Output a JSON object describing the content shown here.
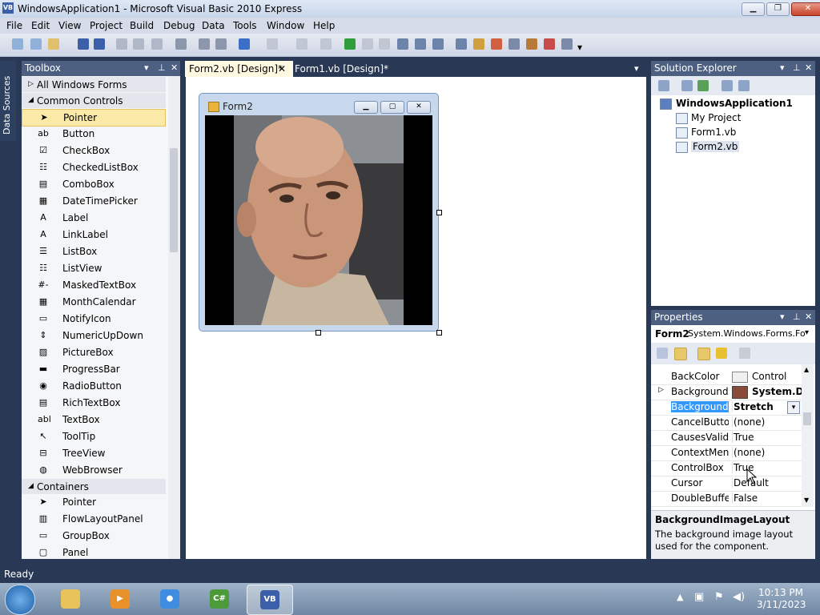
{
  "window": {
    "title": "WindowsApplication1 - Microsoft Visual Basic 2010 Express",
    "app_icon": "VB"
  },
  "menu": [
    "File",
    "Edit",
    "View",
    "Project",
    "Build",
    "Debug",
    "Data",
    "Tools",
    "Window",
    "Help"
  ],
  "data_sources_tab": "Data Sources",
  "toolbox": {
    "title": "Toolbox",
    "rows": [
      {
        "type": "group",
        "label": "All Windows Forms",
        "expanded": false
      },
      {
        "type": "group",
        "label": "Common Controls",
        "expanded": true
      },
      {
        "type": "item",
        "label": "Pointer",
        "icon": "pointer-icon",
        "glyph": "➤",
        "selected": true
      },
      {
        "type": "item",
        "label": "Button",
        "icon": "button-icon",
        "glyph": "ab"
      },
      {
        "type": "item",
        "label": "CheckBox",
        "icon": "checkbox-icon",
        "glyph": "☑"
      },
      {
        "type": "item",
        "label": "CheckedListBox",
        "icon": "checkedlistbox-icon",
        "glyph": "☷"
      },
      {
        "type": "item",
        "label": "ComboBox",
        "icon": "combobox-icon",
        "glyph": "▤"
      },
      {
        "type": "item",
        "label": "DateTimePicker",
        "icon": "datetimepicker-icon",
        "glyph": "▦"
      },
      {
        "type": "item",
        "label": "Label",
        "icon": "label-icon",
        "glyph": "A"
      },
      {
        "type": "item",
        "label": "LinkLabel",
        "icon": "linklabel-icon",
        "glyph": "A"
      },
      {
        "type": "item",
        "label": "ListBox",
        "icon": "listbox-icon",
        "glyph": "☰"
      },
      {
        "type": "item",
        "label": "ListView",
        "icon": "listview-icon",
        "glyph": "☷"
      },
      {
        "type": "item",
        "label": "MaskedTextBox",
        "icon": "maskedtextbox-icon",
        "glyph": "#-"
      },
      {
        "type": "item",
        "label": "MonthCalendar",
        "icon": "monthcalendar-icon",
        "glyph": "▦"
      },
      {
        "type": "item",
        "label": "NotifyIcon",
        "icon": "notifyicon-icon",
        "glyph": "▭"
      },
      {
        "type": "item",
        "label": "NumericUpDown",
        "icon": "numericupdown-icon",
        "glyph": "⇕"
      },
      {
        "type": "item",
        "label": "PictureBox",
        "icon": "picturebox-icon",
        "glyph": "▨"
      },
      {
        "type": "item",
        "label": "ProgressBar",
        "icon": "progressbar-icon",
        "glyph": "▬"
      },
      {
        "type": "item",
        "label": "RadioButton",
        "icon": "radiobutton-icon",
        "glyph": "◉"
      },
      {
        "type": "item",
        "label": "RichTextBox",
        "icon": "richtextbox-icon",
        "glyph": "▤"
      },
      {
        "type": "item",
        "label": "TextBox",
        "icon": "textbox-icon",
        "glyph": "abl"
      },
      {
        "type": "item",
        "label": "ToolTip",
        "icon": "tooltip-icon",
        "glyph": "↖"
      },
      {
        "type": "item",
        "label": "TreeView",
        "icon": "treeview-icon",
        "glyph": "⊟"
      },
      {
        "type": "item",
        "label": "WebBrowser",
        "icon": "webbrowser-icon",
        "glyph": "◍"
      },
      {
        "type": "group",
        "label": "Containers",
        "expanded": true
      },
      {
        "type": "item",
        "label": "Pointer",
        "icon": "pointer-icon",
        "glyph": "➤"
      },
      {
        "type": "item",
        "label": "FlowLayoutPanel",
        "icon": "flowlayoutpanel-icon",
        "glyph": "▥"
      },
      {
        "type": "item",
        "label": "GroupBox",
        "icon": "groupbox-icon",
        "glyph": "▭"
      },
      {
        "type": "item",
        "label": "Panel",
        "icon": "panel-icon",
        "glyph": "▢"
      }
    ]
  },
  "doc_tabs": [
    {
      "label": "Form2.vb [Design]*",
      "active": true
    },
    {
      "label": "Form1.vb [Design]*",
      "active": false
    }
  ],
  "form2": {
    "title": "Form2"
  },
  "solution_explorer": {
    "title": "Solution Explorer",
    "root": "WindowsApplication1",
    "items": [
      "My Project",
      "Form1.vb",
      "Form2.vb"
    ]
  },
  "properties": {
    "title": "Properties",
    "object_name": "Form2",
    "object_type": "System.Windows.Forms.Fo",
    "rows": [
      {
        "name": "BackColor",
        "value": "Control",
        "swatch": "#f0f0f0"
      },
      {
        "name": "BackgroundIm",
        "value": "System.Dr",
        "bold": true,
        "expandable": true,
        "image": true
      },
      {
        "name": "BackgroundIm",
        "value": "Stretch",
        "bold": true,
        "selected": true,
        "dropdown": true
      },
      {
        "name": "CancelButton",
        "value": "(none)"
      },
      {
        "name": "CausesValidat",
        "value": "True"
      },
      {
        "name": "ContextMenu",
        "value": "(none)"
      },
      {
        "name": "ControlBox",
        "value": "True"
      },
      {
        "name": "Cursor",
        "value": "Default"
      },
      {
        "name": "DoubleBuffer",
        "value": "False"
      }
    ],
    "description_title": "BackgroundImageLayout",
    "description_text": "The background image layout used for the component."
  },
  "status": "Ready",
  "taskbar": {
    "apps": [
      {
        "name": "explorer",
        "active": false,
        "color": "#e8c25a",
        "glyph": ""
      },
      {
        "name": "media-player",
        "active": false,
        "color": "#e8912a",
        "glyph": "▶"
      },
      {
        "name": "chrome",
        "active": false,
        "color": "#3e8de0",
        "glyph": "●"
      },
      {
        "name": "csharp-express",
        "active": false,
        "color": "#4c9a3a",
        "glyph": "C#"
      },
      {
        "name": "vb-express",
        "active": true,
        "color": "#3b5fa8",
        "glyph": "VB"
      }
    ],
    "time": "10:13 PM",
    "date": "3/11/2023"
  }
}
